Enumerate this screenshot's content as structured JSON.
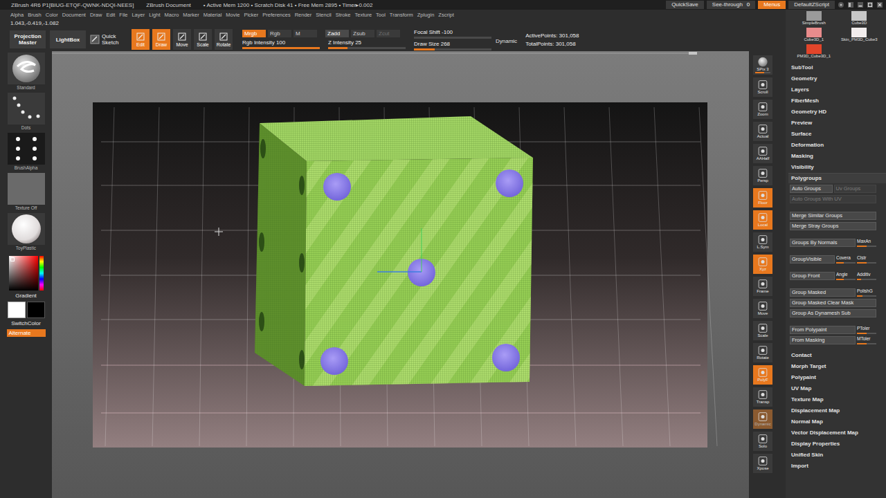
{
  "titlebar": {
    "title": "ZBrush 4R6 P1[BIUG-ETQF-QWNK-NDQI-NEES]",
    "document": "ZBrush Document",
    "stats": "• Active Mem 1200 • Scratch Disk 41 • Free Mem 2895 • Timer▸0.002",
    "buttons": [
      {
        "label": "QuickSave",
        "value": "",
        "selected": false
      },
      {
        "label": "See-through",
        "value": "0",
        "selected": false
      },
      {
        "label": "Menus",
        "value": "",
        "selected": true
      },
      {
        "label": "DefaultZScript",
        "value": "",
        "selected": false
      }
    ]
  },
  "menu": [
    "Alpha",
    "Brush",
    "Color",
    "Document",
    "Draw",
    "Edit",
    "File",
    "Layer",
    "Light",
    "Macro",
    "Marker",
    "Material",
    "Movie",
    "Picker",
    "Preferences",
    "Render",
    "Stencil",
    "Stroke",
    "Texture",
    "Tool",
    "Transform",
    "Zplugin",
    "Zscript"
  ],
  "coords": "1.043,-0.419,-1.082",
  "toolbar": {
    "projection_master": "Projection Master",
    "lightbox": "LightBox",
    "quick_sketch": "Quick Sketch",
    "modes": [
      {
        "label": "Edit",
        "selected": true
      },
      {
        "label": "Draw",
        "selected": true
      },
      {
        "label": "Move",
        "selected": false
      },
      {
        "label": "Scale",
        "selected": false
      },
      {
        "label": "Rotate",
        "selected": false
      }
    ],
    "color_channels": [
      {
        "label": "Mrgb",
        "selected": true,
        "disabled": false
      },
      {
        "label": "Rgb",
        "selected": false,
        "disabled": false
      },
      {
        "label": "M",
        "selected": false,
        "disabled": false
      }
    ],
    "depth_modes": [
      {
        "label": "Zadd",
        "selected": true,
        "disabled": false
      },
      {
        "label": "Zsub",
        "selected": false,
        "disabled": false
      },
      {
        "label": "Zcut",
        "selected": false,
        "disabled": true
      }
    ],
    "intensity_sliders": [
      {
        "label": "Rgb Intensity",
        "value": "100",
        "level": 1
      },
      {
        "label": "Z Intensity",
        "value": "25",
        "level": 0.25
      }
    ],
    "brush_sliders": [
      {
        "label": "Focal Shift",
        "value": "-100",
        "level": 0
      },
      {
        "label": "Draw Size",
        "value": "268",
        "level": 0.27
      }
    ],
    "dynamic": "Dynamic",
    "points": [
      "ActivePoints: 301,058",
      "TotalPoints: 301,058"
    ]
  },
  "left_shelf": {
    "items": [
      {
        "label": "Standard",
        "kind": "brush"
      },
      {
        "label": "Dots",
        "kind": "stroke"
      },
      {
        "label": "BrushAlpha",
        "kind": "alpha"
      },
      {
        "label": "Texture Off",
        "kind": "texture"
      },
      {
        "label": "ToyPlastic",
        "kind": "material"
      }
    ],
    "gradient": "Gradient",
    "swatches": [
      {
        "color": "#ffffff",
        "selected": true
      },
      {
        "color": "#000000",
        "selected": false
      }
    ],
    "switch_color": "SwitchColor",
    "alternate": {
      "label": "Alternate",
      "selected": true
    }
  },
  "right_shelf": {
    "spix": {
      "label": "SPix 3",
      "level": 0.6
    },
    "buttons": [
      {
        "label": "Scroll",
        "selected": false,
        "disabled": false
      },
      {
        "label": "Zoom",
        "selected": false,
        "disabled": false
      },
      {
        "label": "Actual",
        "selected": false,
        "disabled": false
      },
      {
        "label": "AAHalf",
        "selected": false,
        "disabled": false
      },
      {
        "label": "Persp",
        "selected": false,
        "disabled": false
      },
      {
        "label": "Floor",
        "selected": true,
        "disabled": false
      },
      {
        "label": "Local",
        "selected": true,
        "disabled": false
      },
      {
        "label": "L.Sym",
        "selected": false,
        "disabled": false
      },
      {
        "label": "Xyz",
        "selected": true,
        "disabled": false
      },
      {
        "label": "Frame",
        "selected": false,
        "disabled": false
      },
      {
        "label": "Move",
        "selected": false,
        "disabled": false
      },
      {
        "label": "Scale",
        "selected": false,
        "disabled": false
      },
      {
        "label": "Rotate",
        "selected": false,
        "disabled": false
      },
      {
        "label": "PolyF",
        "selected": true,
        "disabled": false
      },
      {
        "label": "Transp",
        "selected": false,
        "disabled": false
      },
      {
        "label": "Dynamic",
        "selected": true,
        "disabled": true
      },
      {
        "label": "Solo",
        "selected": false,
        "disabled": false
      },
      {
        "label": "Xpose",
        "selected": false,
        "disabled": false
      }
    ]
  },
  "tray": {
    "tools": [
      {
        "label": "SimpleBrush",
        "color": "#9a9a9a"
      },
      {
        "label": "Cube3D",
        "color": "#c8c8c8"
      },
      {
        "label": "Cube3D_1",
        "color": "#e98c8c"
      },
      {
        "label": "Skin_PM3D_Cube3",
        "color": "#f2eded"
      },
      {
        "label": "PM3D_Cube3D_1",
        "color": "#e2452a"
      }
    ],
    "panels_before": [
      "SubTool",
      "Geometry",
      "Layers",
      "FiberMesh",
      "Geometry HD",
      "Preview",
      "Surface",
      "Deformation",
      "Masking",
      "Visibility"
    ],
    "open_panel": {
      "title": "Polygroups",
      "expanded": true,
      "sections": [
        [
          [
            {
              "label": "Auto Groups",
              "kind": "button",
              "disabled": false
            },
            {
              "label": "Uv Groups",
              "kind": "button",
              "disabled": true
            }
          ],
          [
            {
              "label": "Auto Groups With UV",
              "kind": "button",
              "disabled": true
            }
          ]
        ],
        [
          [
            {
              "label": "Merge Similar Groups",
              "kind": "button",
              "disabled": false
            }
          ],
          [
            {
              "label": "Merge Stray Groups",
              "kind": "button",
              "disabled": false
            }
          ]
        ],
        [
          [
            {
              "label": "Groups By Normals",
              "kind": "button",
              "disabled": false
            },
            {
              "label": "MaxAn",
              "kind": "slider",
              "level": 0.5
            }
          ]
        ],
        [
          [
            {
              "label": "GroupVisible",
              "kind": "button",
              "disabled": false
            },
            {
              "label": "Covera",
              "kind": "slider",
              "level": 0.4
            },
            {
              "label": "Clstr",
              "kind": "slider",
              "level": 0.5
            }
          ]
        ],
        [
          [
            {
              "label": "Group Front",
              "kind": "button",
              "disabled": false
            },
            {
              "label": "Angle",
              "kind": "slider",
              "level": 0.4
            },
            {
              "label": "Additiv",
              "kind": "slider",
              "level": 0.2
            }
          ]
        ],
        [
          [
            {
              "label": "Group Masked",
              "kind": "button",
              "disabled": false
            },
            {
              "label": "PolishG",
              "kind": "slider",
              "level": 0.3
            }
          ],
          [
            {
              "label": "Group Masked Clear Mask",
              "kind": "button",
              "disabled": false
            }
          ],
          [
            {
              "label": "Group As Dynamesh Sub",
              "kind": "button",
              "disabled": false
            }
          ]
        ],
        [
          [
            {
              "label": "From Polypaint",
              "kind": "button",
              "disabled": false
            },
            {
              "label": "PToler",
              "kind": "slider",
              "level": 0.5
            }
          ],
          [
            {
              "label": "From Masking",
              "kind": "button",
              "disabled": false
            },
            {
              "label": "MToler",
              "kind": "slider",
              "level": 0.5
            }
          ]
        ]
      ]
    },
    "panels_after": [
      "Contact",
      "Morph Target",
      "Polypaint",
      "UV Map",
      "Texture Map",
      "Displacement Map",
      "Normal Map",
      "Vector Displacement Map",
      "Display Properties",
      "Unified Skin",
      "Import"
    ]
  }
}
